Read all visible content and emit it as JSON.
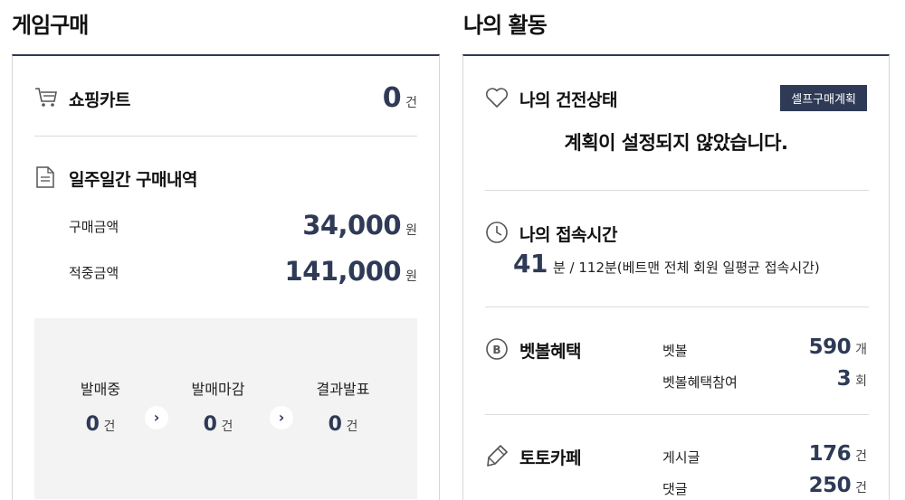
{
  "purchase": {
    "section_title": "게임구매",
    "cart": {
      "label": "쇼핑카트",
      "count": "0",
      "unit": "건"
    },
    "weekly": {
      "label": "일주일간 구매내역",
      "rows": [
        {
          "label": "구매금액",
          "value": "34,000",
          "unit": "원"
        },
        {
          "label": "적중금액",
          "value": "141,000",
          "unit": "원"
        }
      ]
    },
    "stages": [
      {
        "label": "발매중",
        "count": "0",
        "unit": "건"
      },
      {
        "label": "발매마감",
        "count": "0",
        "unit": "건"
      },
      {
        "label": "결과발표",
        "count": "0",
        "unit": "건"
      }
    ]
  },
  "activity": {
    "section_title": "나의 활동",
    "health": {
      "label": "나의 건전상태",
      "button": "셀프구매계획",
      "notice": "계획이 설정되지 않았습니다."
    },
    "access": {
      "label": "나의 접속시간",
      "minutes": "41",
      "detail": "분 / 112분(베트맨 전체 회원 일평균 접속시간)"
    },
    "benefit": {
      "label": "벳볼혜택",
      "rows": [
        {
          "label": "벳볼",
          "value": "590",
          "unit": "개"
        },
        {
          "label": "벳볼혜택참여",
          "value": "3",
          "unit": "회"
        }
      ]
    },
    "cafe": {
      "label": "토토카페",
      "rows": [
        {
          "label": "게시글",
          "value": "176",
          "unit": "건"
        },
        {
          "label": "댓글",
          "value": "250",
          "unit": "건"
        }
      ]
    }
  }
}
